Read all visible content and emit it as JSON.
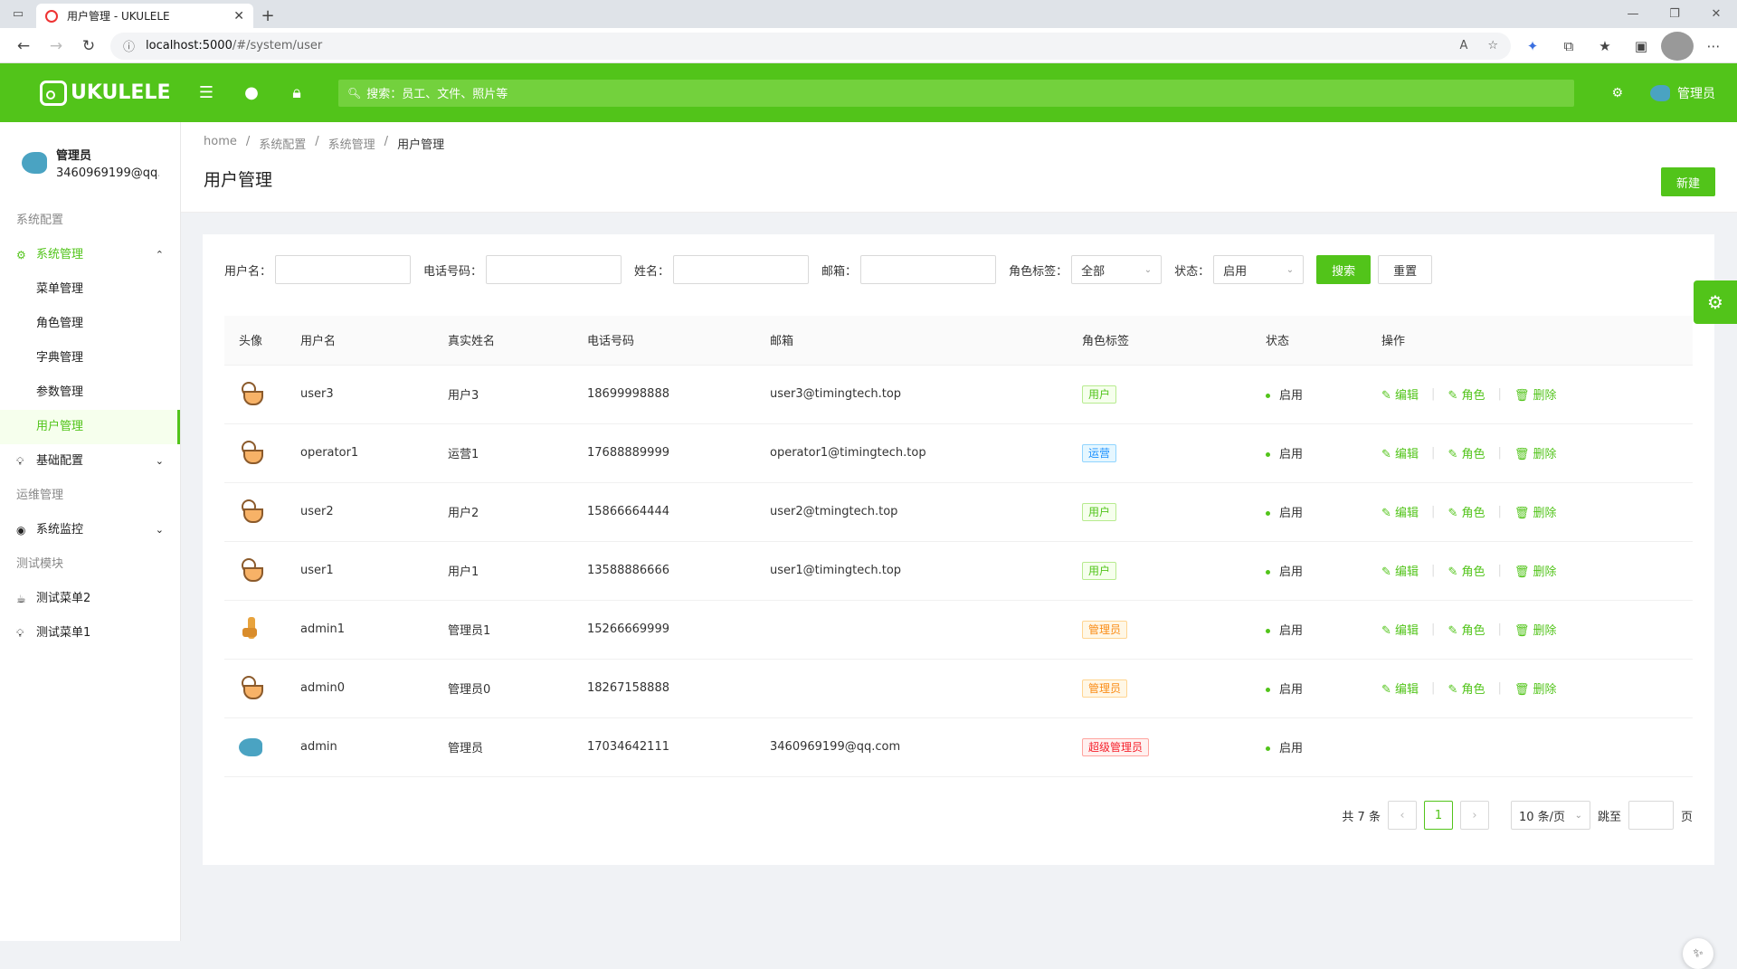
{
  "browser": {
    "tab_title": "用户管理 - UKULELE",
    "url_host": "localhost:5000",
    "url_path": "/#/system/user"
  },
  "header": {
    "logo": "UKULELE",
    "search_placeholder": "搜索：员工、文件、照片等",
    "username": "管理员"
  },
  "sidebar": {
    "profile_name": "管理员",
    "profile_email": "3460969199@qq.com",
    "group1": "系统配置",
    "sys_mgmt": "系统管理",
    "items": [
      "菜单管理",
      "角色管理",
      "字典管理",
      "参数管理",
      "用户管理"
    ],
    "basic": "基础配置",
    "group2": "运维管理",
    "monitor": "系统监控",
    "group3": "测试模块",
    "test2": "测试菜单2",
    "test1": "测试菜单1"
  },
  "breadcrumb": [
    "home",
    "系统配置",
    "系统管理",
    "用户管理"
  ],
  "page": {
    "title": "用户管理",
    "new_button": "新建"
  },
  "filters": {
    "username": "用户名：",
    "phone": "电话号码：",
    "name": "姓名：",
    "email": "邮箱：",
    "role": "角色标签：",
    "role_value": "全部",
    "status": "状态：",
    "status_value": "启用",
    "search": "搜索",
    "reset": "重置"
  },
  "table": {
    "headers": [
      "头像",
      "用户名",
      "真实姓名",
      "电话号码",
      "邮箱",
      "角色标签",
      "状态",
      "操作"
    ],
    "rows": [
      {
        "username": "user3",
        "realname": "用户3",
        "phone": "18699998888",
        "email": "user3@timingtech.top",
        "role": "用户",
        "status": "启用"
      },
      {
        "username": "operator1",
        "realname": "运营1",
        "phone": "17688889999",
        "email": "operator1@timingtech.top",
        "role": "运营",
        "status": "启用"
      },
      {
        "username": "user2",
        "realname": "用户2",
        "phone": "15866664444",
        "email": "user2@tmingtech.top",
        "role": "用户",
        "status": "启用"
      },
      {
        "username": "user1",
        "realname": "用户1",
        "phone": "13588886666",
        "email": "user1@timingtech.top",
        "role": "用户",
        "status": "启用"
      },
      {
        "username": "admin1",
        "realname": "管理员1",
        "phone": "15266669999",
        "email": "",
        "role": "管理员",
        "status": "启用"
      },
      {
        "username": "admin0",
        "realname": "管理员0",
        "phone": "18267158888",
        "email": "",
        "role": "管理员",
        "status": "启用"
      },
      {
        "username": "admin",
        "realname": "管理员",
        "phone": "17034642111",
        "email": "3460969199@qq.com",
        "role": "超级管理员",
        "status": "启用"
      }
    ],
    "ops": {
      "edit": "编辑",
      "role": "角色",
      "delete": "删除"
    }
  },
  "pager": {
    "total": "共 7 条",
    "page": "1",
    "size": "10 条/页",
    "jump": "跳至",
    "page_unit": "页"
  }
}
